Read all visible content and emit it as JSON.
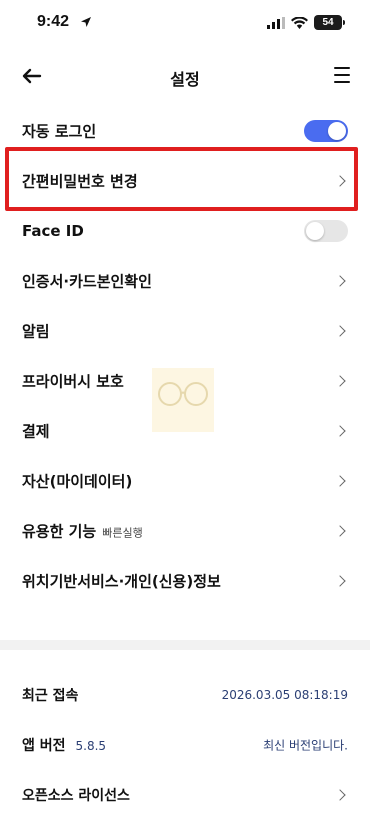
{
  "status": {
    "time": "9:42",
    "battery": "54"
  },
  "header": {
    "title": "설정"
  },
  "settings": [
    {
      "label": "자동 로그인",
      "type": "toggle",
      "on": true
    },
    {
      "label": "간편비밀번호 변경",
      "type": "link"
    },
    {
      "label": "Face ID",
      "type": "toggle",
      "on": false
    },
    {
      "label": "인증서·카드본인확인",
      "type": "link"
    },
    {
      "label": "알림",
      "type": "link"
    },
    {
      "label": "프라이버시 보호",
      "type": "link"
    },
    {
      "label": "결제",
      "type": "link"
    },
    {
      "label": "자산(마이데이터)",
      "type": "link"
    },
    {
      "label": "유용한 기능",
      "sub": "빠른실행",
      "type": "link"
    },
    {
      "label": "위치기반서비스·개인(신용)정보",
      "type": "link"
    }
  ],
  "info": {
    "recent_label": "최근 접속",
    "recent_value": "2026.03.05 08:18:19",
    "app_label": "앱 버전",
    "app_version": "5.8.5",
    "app_status": "최신 버전입니다.",
    "oss_label": "오픈소스 라이선스"
  },
  "colors": {
    "accent": "#4a6cf0",
    "highlight": "#e01f1f"
  }
}
